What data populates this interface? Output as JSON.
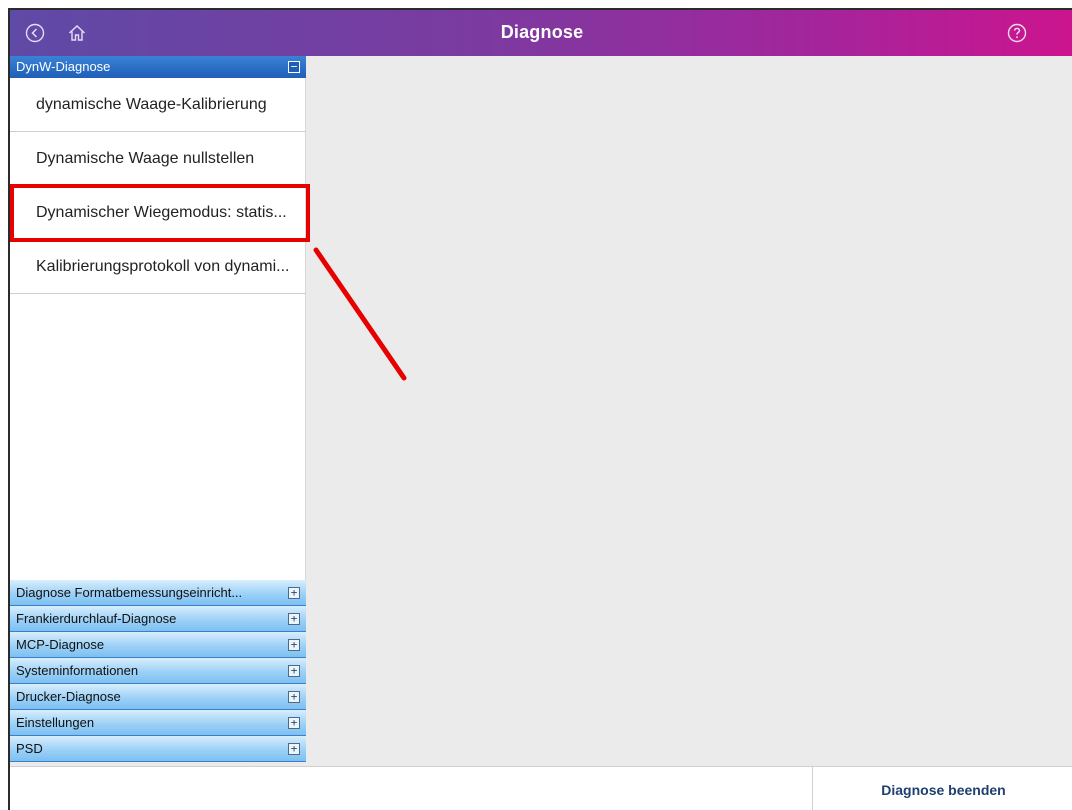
{
  "window": {
    "title": "Diagnose"
  },
  "icons": {
    "back": "back-circle-icon",
    "home": "home-icon",
    "help": "help-circle-icon"
  },
  "sidebar": {
    "active_group": {
      "label": "DynW-Diagnose",
      "toggle": "−",
      "items": [
        {
          "label": "dynamische Waage-Kalibrierung"
        },
        {
          "label": "Dynamische Waage nullstellen"
        },
        {
          "label": "Dynamischer Wiegemodus: statis..."
        },
        {
          "label": "Kalibrierungsprotokoll von dynami..."
        }
      ]
    },
    "collapsed_groups": [
      {
        "label": "Diagnose Formatbemessungseinricht...",
        "toggle": "+"
      },
      {
        "label": "Frankierdurchlauf-Diagnose",
        "toggle": "+"
      },
      {
        "label": "MCP-Diagnose",
        "toggle": "+"
      },
      {
        "label": "Systeminformationen",
        "toggle": "+"
      },
      {
        "label": "Drucker-Diagnose",
        "toggle": "+"
      },
      {
        "label": "Einstellungen",
        "toggle": "+"
      },
      {
        "label": "PSD",
        "toggle": "+"
      }
    ]
  },
  "footer": {
    "end_button": "Diagnose beenden"
  },
  "colors": {
    "annotation": "#e60000",
    "title_gradient_start": "#5f4aa6",
    "title_gradient_end": "#cc148e",
    "active_header": "#1f5fb8"
  }
}
